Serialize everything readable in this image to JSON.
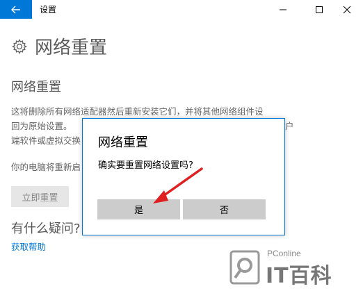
{
  "window": {
    "title": "设置",
    "controls": [
      "minimize-icon",
      "maximize-icon",
      "close-icon"
    ]
  },
  "page": {
    "title": "网络重置",
    "icon": "gear-icon"
  },
  "content": {
    "section_title": "网络重置",
    "description_line1": "这将删除所有网络适配器然后重新安装它们，并将其他网络组件设",
    "description_line2": "回为原始设置。",
    "description_line2_tail": "户",
    "description_line3": "端软件或虚拟交换",
    "restart_note": "你的电脑将重新启",
    "reset_button": "立即重置",
    "help_heading": "有什么疑问?",
    "help_link": "获取帮助"
  },
  "dialog": {
    "title": "网络重置",
    "message": "确实要重置网络设置吗?",
    "yes_label": "是",
    "no_label": "否"
  },
  "watermark": {
    "small_text": "PConline",
    "big_text": "IT百科"
  },
  "colors": {
    "accent": "#0078d7",
    "annotation_arrow": "#e02020"
  }
}
